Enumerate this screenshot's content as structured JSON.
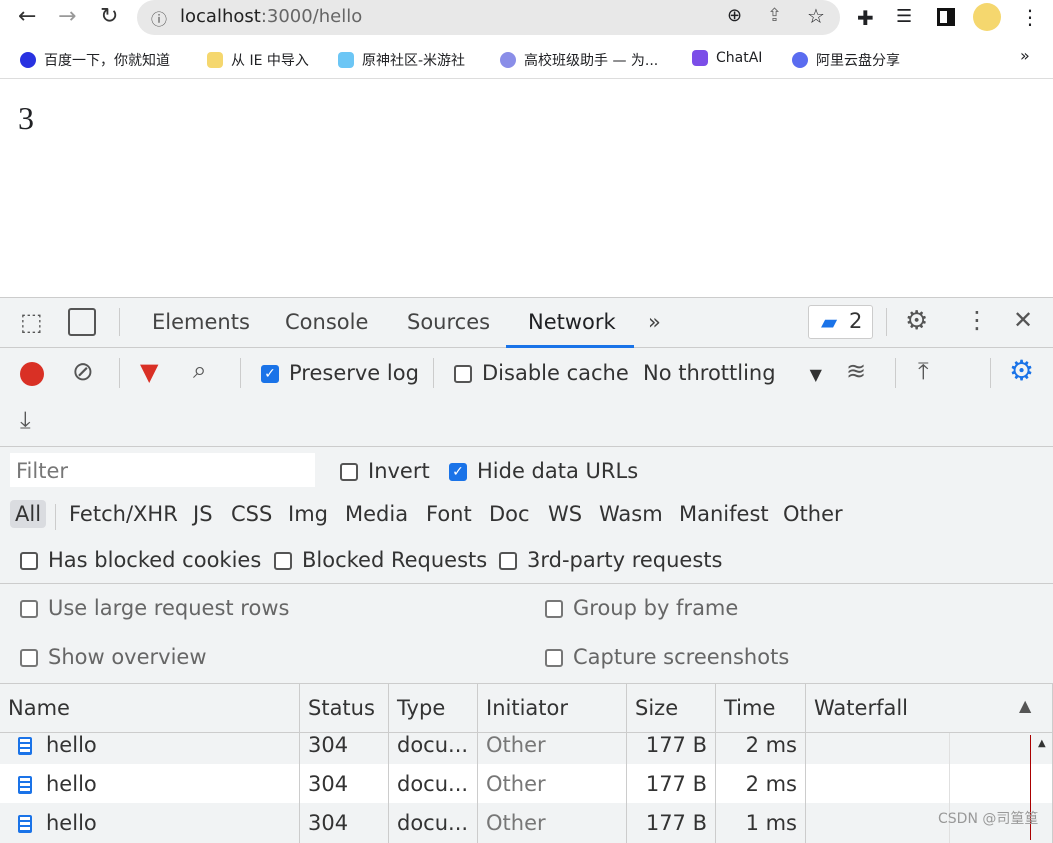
{
  "browser": {
    "url_host": "localhost",
    "url_rest": ":3000/hello",
    "bookmarks": [
      {
        "label": "百度一下，你就知道",
        "color": "#2932e1"
      },
      {
        "label": "从 IE 中导入",
        "color": "#f5d76e"
      },
      {
        "label": "原神社区-米游社",
        "color": "#6cc6f5"
      },
      {
        "label": "高校班级助手 — 为...",
        "color": "#8a8ee8"
      },
      {
        "label": "ChatAI",
        "color": "#7b4ee8"
      },
      {
        "label": "阿里云盘分享",
        "color": "#5a6cf0"
      }
    ],
    "more": "»"
  },
  "page": {
    "content": "3"
  },
  "devtools": {
    "tabs": [
      "Elements",
      "Console",
      "Sources",
      "Network"
    ],
    "active_tab": "Network",
    "more": "»",
    "issues_count": "2",
    "toolbar": {
      "preserve_log": "Preserve log",
      "preserve_checked": true,
      "disable_cache": "Disable cache",
      "throttling": "No throttling"
    },
    "filter": {
      "placeholder": "Filter",
      "invert": "Invert",
      "hide_data_urls": "Hide data URLs",
      "hide_checked": true
    },
    "types": [
      "All",
      "Fetch/XHR",
      "JS",
      "CSS",
      "Img",
      "Media",
      "Font",
      "Doc",
      "WS",
      "Wasm",
      "Manifest",
      "Other"
    ],
    "blocked": [
      "Has blocked cookies",
      "Blocked Requests",
      "3rd-party requests"
    ],
    "settings": [
      "Use large request rows",
      "Group by frame",
      "Show overview",
      "Capture screenshots"
    ],
    "columns": [
      "Name",
      "Status",
      "Type",
      "Initiator",
      "Size",
      "Time",
      "Waterfall"
    ],
    "rows": [
      [
        "hello",
        "304",
        "docu...",
        "Other",
        "177 B",
        "2 ms"
      ],
      [
        "hello",
        "304",
        "docu...",
        "Other",
        "177 B",
        "2 ms"
      ],
      [
        "hello",
        "304",
        "docu...",
        "Other",
        "177 B",
        "1 ms"
      ]
    ]
  },
  "watermark": "CSDN @司篁篁"
}
